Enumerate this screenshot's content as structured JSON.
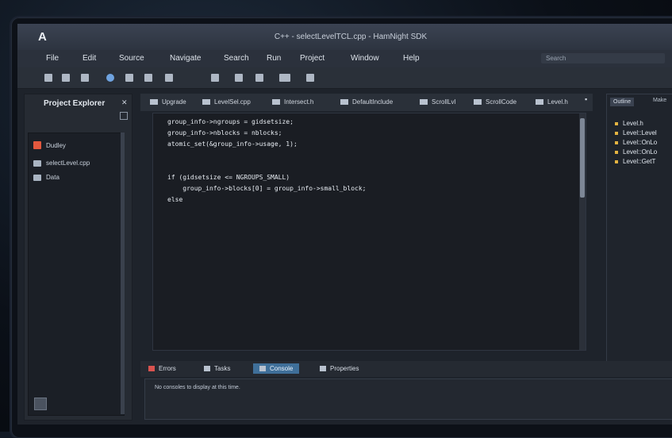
{
  "window": {
    "title": "C++ - selectLevelTCL.cpp - HamNight SDK",
    "logo": "A"
  },
  "menu": [
    "File",
    "Edit",
    "Source",
    "Navigate",
    "Search",
    "Run",
    "Project",
    "Window",
    "Help"
  ],
  "search": {
    "placeholder": "Search"
  },
  "explorer": {
    "title": "Project Explorer",
    "items": [
      "Dudley",
      "selectLevel.cpp",
      "Data"
    ]
  },
  "editor": {
    "tabs": [
      "Upgrade",
      "LevelSel.cpp",
      "Intersect.h",
      "DefaultInclude",
      "ScrollLvl",
      "ScrollCode",
      "Level.h"
    ],
    "code": [
      "group_info->ngroups = gidsetsize;",
      "group_info->nblocks = nblocks;",
      "atomic_set(&group_info->usage, 1);",
      "",
      "",
      "if (gidsetsize <= NGROUPS_SMALL)",
      "    group_info->blocks[0] = group_info->small_block;",
      "else"
    ]
  },
  "outline": {
    "tabs": [
      "Outline",
      "Make"
    ],
    "items": [
      "Level.h",
      "Level::Level",
      "Level::OnLo",
      "Level::OnLo",
      "Level::GetT"
    ]
  },
  "bottom": {
    "tabs": [
      "Errors",
      "Tasks",
      "Console",
      "Properties"
    ],
    "active_tab": "Console",
    "console_message": "No consoles to display at this time."
  }
}
